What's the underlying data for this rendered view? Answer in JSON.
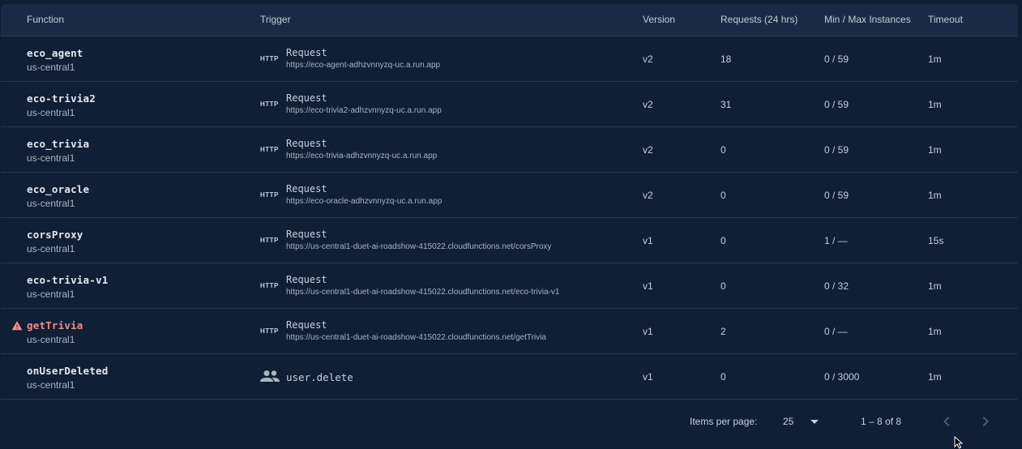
{
  "headers": {
    "function": "Function",
    "trigger": "Trigger",
    "version": "Version",
    "requests": "Requests (24 hrs)",
    "instances": "Min / Max Instances",
    "timeout": "Timeout"
  },
  "http_badge": "HTTP",
  "rows": [
    {
      "name": "eco_agent",
      "region": "us-central1",
      "trigger_type": "Request",
      "url": "https://eco-agent-adhzvnnyzq-uc.a.run.app",
      "version": "v2",
      "requests": "18",
      "instances": "0 / 59",
      "timeout": "1m"
    },
    {
      "name": "eco-trivia2",
      "region": "us-central1",
      "trigger_type": "Request",
      "url": "https://eco-trivia2-adhzvnnyzq-uc.a.run.app",
      "version": "v2",
      "requests": "31",
      "instances": "0 / 59",
      "timeout": "1m"
    },
    {
      "name": "eco_trivia",
      "region": "us-central1",
      "trigger_type": "Request",
      "url": "https://eco-trivia-adhzvnnyzq-uc.a.run.app",
      "version": "v2",
      "requests": "0",
      "instances": "0 / 59",
      "timeout": "1m"
    },
    {
      "name": "eco_oracle",
      "region": "us-central1",
      "trigger_type": "Request",
      "url": "https://eco-oracle-adhzvnnyzq-uc.a.run.app",
      "version": "v2",
      "requests": "0",
      "instances": "0 / 59",
      "timeout": "1m"
    },
    {
      "name": "corsProxy",
      "region": "us-central1",
      "trigger_type": "Request",
      "url": "https://us-central1-duet-ai-roadshow-415022.cloudfunctions.net/corsProxy",
      "version": "v1",
      "requests": "0",
      "instances": "1 / —",
      "timeout": "15s"
    },
    {
      "name": "eco-trivia-v1",
      "region": "us-central1",
      "trigger_type": "Request",
      "url": "https://us-central1-duet-ai-roadshow-415022.cloudfunctions.net/eco-trivia-v1",
      "version": "v1",
      "requests": "0",
      "instances": "0 / 32",
      "timeout": "1m"
    },
    {
      "name": "getTrivia",
      "region": "us-central1",
      "trigger_type": "Request",
      "url": "https://us-central1-duet-ai-roadshow-415022.cloudfunctions.net/getTrivia",
      "version": "v1",
      "requests": "2",
      "instances": "0 / —",
      "timeout": "1m",
      "warning": true
    },
    {
      "name": "onUserDeleted",
      "region": "us-central1",
      "event": "user.delete",
      "version": "v1",
      "requests": "0",
      "instances": "0 / 3000",
      "timeout": "1m"
    }
  ],
  "footer": {
    "items_per_page_label": "Items per page:",
    "items_per_page": "25",
    "range": "1 – 8 of 8"
  },
  "colors": {
    "background": "#0f1f36",
    "header": "#192b44",
    "warning": "#f28b82"
  },
  "icons": [
    "warning-icon",
    "people-icon",
    "chevron-down-icon",
    "chevron-left-icon",
    "chevron-right-icon"
  ]
}
